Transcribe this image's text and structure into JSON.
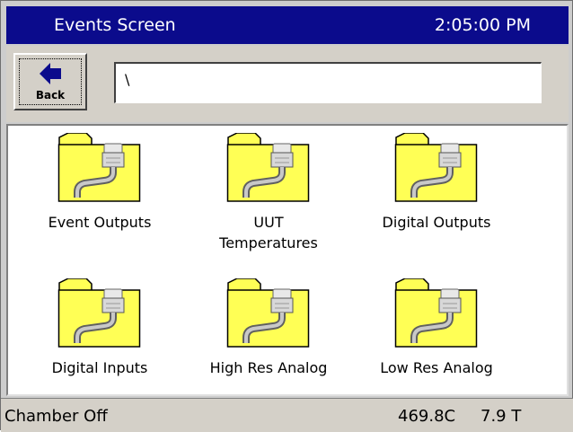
{
  "header": {
    "title": "Events Screen",
    "time": "2:05:00 PM"
  },
  "toolbar": {
    "back_label": "Back",
    "path_value": "\\"
  },
  "folders": [
    {
      "label": "Event Outputs"
    },
    {
      "label": "UUT\nTemperatures"
    },
    {
      "label": "Digital Outputs"
    },
    {
      "label": "Digital Inputs"
    },
    {
      "label": "High Res Analog"
    },
    {
      "label": "Low Res Analog"
    }
  ],
  "status": {
    "state": "Chamber Off",
    "temperature": "469.8C",
    "humidity": "7.9 T"
  },
  "colors": {
    "title_bar": "#0b0b8c",
    "folder": "#ffff55",
    "frame": "#cdcdcd"
  },
  "icons": {
    "back": "left-arrow-icon",
    "folder": "plug-folder-icon"
  }
}
